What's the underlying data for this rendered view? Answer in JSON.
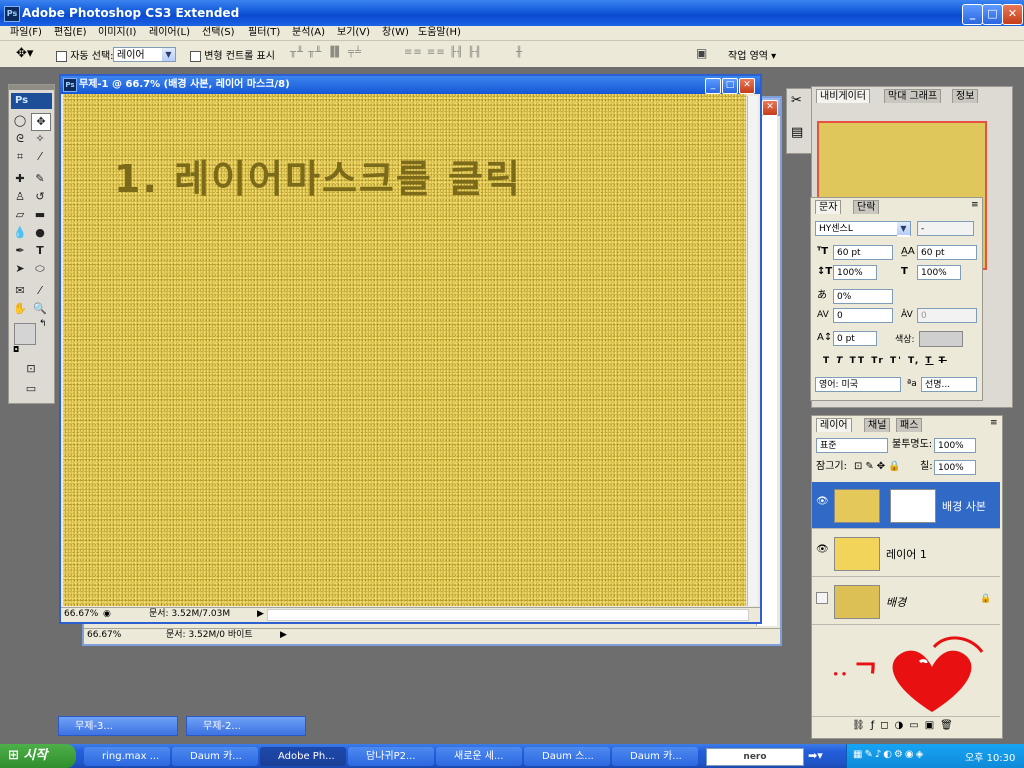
{
  "app": {
    "title": "Adobe Photoshop CS3 Extended"
  },
  "menu": [
    "파일(F)",
    "편집(E)",
    "이미지(I)",
    "레이어(L)",
    "선택(S)",
    "필터(T)",
    "분석(A)",
    "보기(V)",
    "창(W)",
    "도움말(H)"
  ],
  "options": {
    "auto_select_label": "자동 선택:",
    "auto_select_value": "레이어",
    "transform_controls_label": "변형 컨트롤 표시",
    "workspace_label": "작업 영역 ▾"
  },
  "toolbox": {
    "logo": "Ps"
  },
  "document": {
    "title": "무제-1 @ 66.7% (배경 사본, 레이어 마스크/8)",
    "canvas_text": "1. 레이어마스크를 클릭",
    "zoom": "66.67%",
    "doc_info": "문서: 3.52M/7.03M"
  },
  "document_back": {
    "zoom": "66.67%",
    "doc_info": "문서: 3.52M/0 바이트"
  },
  "navigator": {
    "tabs": [
      "내비게이터",
      "막대 그래프",
      "정보"
    ]
  },
  "character": {
    "tabs": [
      "문자",
      "단락"
    ],
    "font_family": "HY센스L",
    "font_style": "-",
    "size": "60 pt",
    "leading": "60 pt",
    "vscale": "100%",
    "hscale": "100%",
    "tracking_pct": "0%",
    "kerning": "0",
    "tracking": "0",
    "baseline": "0 pt",
    "color_label": "색상:",
    "style_buttons": [
      "T",
      "T",
      "TT",
      "Tr",
      "T'",
      "T,",
      "T",
      "T"
    ],
    "language": "영어: 미국",
    "aa_label": "ªa",
    "antialias": "선명..."
  },
  "layers": {
    "tabs": [
      "레이어",
      "채널",
      "패스"
    ],
    "blend_mode": "표준",
    "opacity_label": "불투명도:",
    "opacity": "100%",
    "lock_label": "잠그기:",
    "fill_label": "칠:",
    "fill": "100%",
    "items": [
      {
        "name": "배경 사본",
        "visible": true,
        "selected": true,
        "mask": true
      },
      {
        "name": "레이어 1",
        "visible": true,
        "selected": false,
        "mask": false
      },
      {
        "name": "배경",
        "visible": false,
        "selected": false,
        "mask": false,
        "locked": true
      }
    ]
  },
  "minimized": [
    {
      "title": "무제-3..."
    },
    {
      "title": "무제-2..."
    }
  ],
  "taskbar": {
    "start": "시작",
    "tasks": [
      "ring.max ...",
      "Daum 카...",
      "Adobe Ph...",
      "담나귀P2...",
      "새로운 세...",
      "Daum 스...",
      "Daum 카..."
    ],
    "search_logo": "nero",
    "clock": "오후 10:30"
  },
  "colors": {
    "accent": "#2d5fd0",
    "canvas": "#d9bf4a",
    "heart": "#e81010"
  }
}
